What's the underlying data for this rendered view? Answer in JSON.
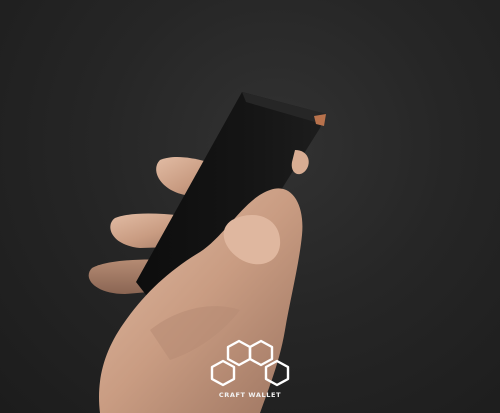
{
  "scene": {
    "subject": "hand-holding-black-wallet",
    "background_color": "#232323",
    "device_color": "#111111",
    "skin_color": "#c79a7f",
    "accent_color": "#b8724c"
  },
  "branding": {
    "logo_text": "CRAFT WALLET",
    "logo_color": "#ffffff",
    "logo_icon": "hexagon-cluster-icon"
  }
}
